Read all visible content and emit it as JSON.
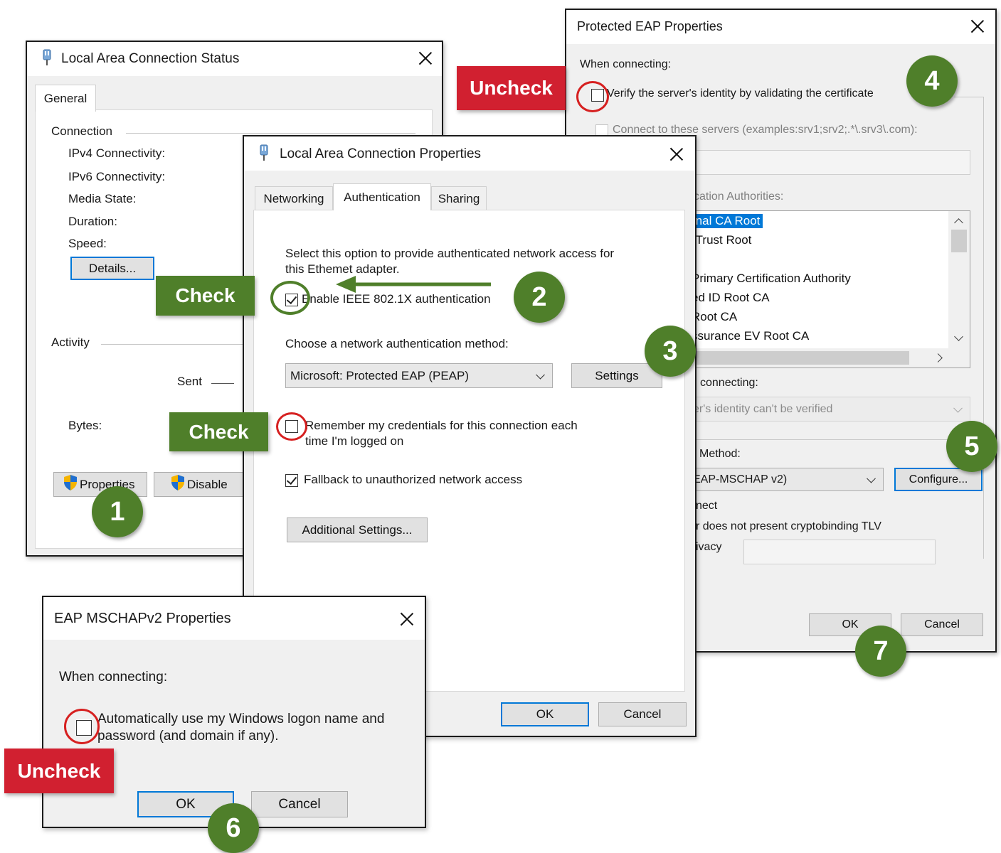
{
  "status_window": {
    "title": "Local Area Connection Status",
    "tab_general": "General",
    "connection_heading": "Connection",
    "ipv4": "IPv4 Connectivity:",
    "ipv6": "IPv6 Connectivity:",
    "media_state": "Media State:",
    "duration": "Duration:",
    "speed": "Speed:",
    "details_button": "Details...",
    "activity_heading": "Activity",
    "sent": "Sent",
    "bytes": "Bytes:",
    "properties_button": "Properties",
    "disable_button": "Disable"
  },
  "peap_window": {
    "title": "Protected EAP Properties",
    "when_connecting": "When connecting:",
    "verify_server": "Verify the server's identity by validating the certificate",
    "connect_to_servers": "Connect to these servers (examples:srv1;srv2;.*\\.srv3\\.com):",
    "trusted_ca_label": "fication Authorities:",
    "ca_list": [
      "rnal CA Root",
      "rTrust Root",
      "Primary Certification Authority",
      "ed ID Root CA",
      "Root CA",
      "ssurance EV Root CA"
    ],
    "notifications_label": "connecting:",
    "notification_value": "er's identity can't be verified",
    "method_label": "Method:",
    "method_value": "EAP-MSCHAP v2)",
    "configure_button": "Configure...",
    "disconnect_label": "nect",
    "cryptobinding_label": "r does not present cryptobinding TLV",
    "privacy_label": "ivacy",
    "ok_button": "OK",
    "cancel_button": "Cancel"
  },
  "props_window": {
    "title": "Local Area Connection Properties",
    "tabs": [
      "Networking",
      "Authentication",
      "Sharing"
    ],
    "description_line1": "Select this option to provide authenticated network access for",
    "description_line2": "this Ethemet adapter.",
    "enable_8021x": "Enable IEEE 802.1X authentication",
    "choose_method": "Choose a network authentication method:",
    "method_value": "Microsoft: Protected EAP (PEAP)",
    "settings_button": "Settings",
    "remember_line1": "Remember my credentials for this connection each",
    "remember_line2": "time I'm logged on",
    "fallback": "Fallback to unauthorized network access",
    "additional_settings_button": "Additional Settings...",
    "ok_button": "OK",
    "cancel_button": "Cancel"
  },
  "mschap_window": {
    "title": "EAP MSCHAPv2 Properties",
    "when_connecting": "When connecting:",
    "auto_logon_line1": "Automatically use my Windows logon name and",
    "auto_logon_line2": "password (and domain if any).",
    "ok_button": "OK",
    "cancel_button": "Cancel"
  },
  "annotations": {
    "steps": [
      "1",
      "2",
      "3",
      "4",
      "5",
      "6",
      "7"
    ],
    "check_label": "Check",
    "uncheck_label": "Uncheck",
    "colors": {
      "green": "#4f7f2a",
      "red": "#d12030",
      "accent": "#0078d7"
    }
  }
}
